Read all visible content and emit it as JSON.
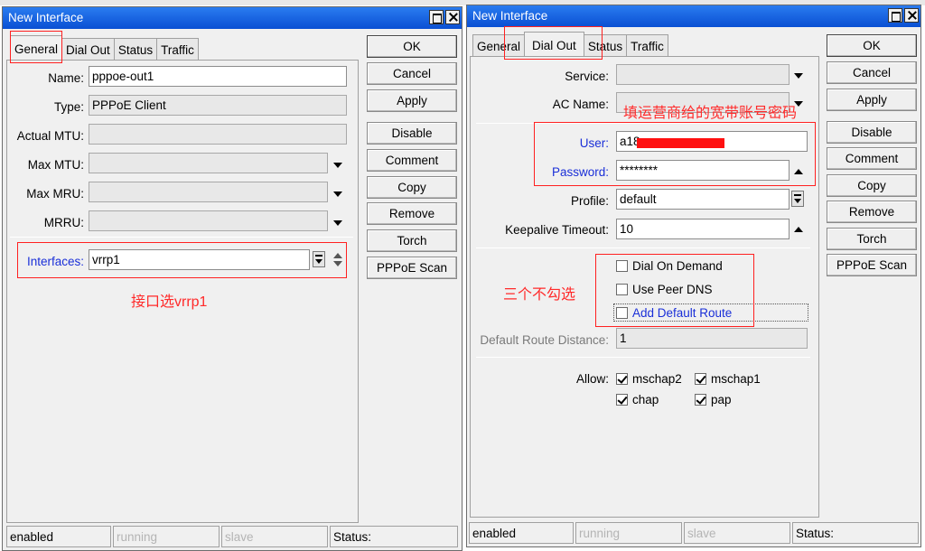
{
  "left_window": {
    "title": "New Interface",
    "tabs": [
      "General",
      "Dial Out",
      "Status",
      "Traffic"
    ],
    "active_tab": "General",
    "fields": {
      "name": {
        "label": "Name:",
        "value": "pppoe-out1"
      },
      "type": {
        "label": "Type:",
        "value": "PPPoE Client"
      },
      "actual_mtu": {
        "label": "Actual MTU:",
        "value": ""
      },
      "max_mtu": {
        "label": "Max MTU:",
        "value": ""
      },
      "max_mru": {
        "label": "Max MRU:",
        "value": ""
      },
      "mrru": {
        "label": "MRRU:",
        "value": ""
      },
      "interfaces": {
        "label": "Interfaces:",
        "value": "vrrp1"
      }
    },
    "buttons": [
      "OK",
      "Cancel",
      "Apply",
      "Disable",
      "Comment",
      "Copy",
      "Remove",
      "Torch",
      "PPPoE Scan"
    ],
    "status": [
      "enabled",
      "running",
      "slave",
      "Status:"
    ],
    "annotation": "接口选vrrp1"
  },
  "right_window": {
    "title": "New Interface",
    "tabs": [
      "General",
      "Dial Out",
      "Status",
      "Traffic"
    ],
    "active_tab": "Dial Out",
    "fields": {
      "service": {
        "label": "Service:",
        "value": ""
      },
      "ac_name": {
        "label": "AC Name:",
        "value": ""
      },
      "user": {
        "label": "User:",
        "value": "a18"
      },
      "password": {
        "label": "Password:",
        "value": "********"
      },
      "profile": {
        "label": "Profile:",
        "value": "default"
      },
      "keepalive": {
        "label": "Keepalive Timeout:",
        "value": "10"
      },
      "default_route_distance": {
        "label": "Default Route Distance:",
        "value": "1"
      }
    },
    "checkboxes": {
      "dial_on_demand": {
        "label": "Dial On Demand",
        "checked": false
      },
      "use_peer_dns": {
        "label": "Use Peer DNS",
        "checked": false
      },
      "add_default_route": {
        "label": "Add Default Route",
        "checked": false
      }
    },
    "allow": {
      "label": "Allow:",
      "mschap2": {
        "label": "mschap2",
        "checked": true
      },
      "mschap1": {
        "label": "mschap1",
        "checked": true
      },
      "chap": {
        "label": "chap",
        "checked": true
      },
      "pap": {
        "label": "pap",
        "checked": true
      }
    },
    "buttons": [
      "OK",
      "Cancel",
      "Apply",
      "Disable",
      "Comment",
      "Copy",
      "Remove",
      "Torch",
      "PPPoE Scan"
    ],
    "status": [
      "enabled",
      "running",
      "slave",
      "Status:"
    ],
    "annotation_account": "填运营商给的宽带账号密码",
    "annotation_checkboxes": "三个不勾选"
  },
  "colors": {
    "title_bar": "#0a4fd3",
    "annotation_red": "#ff2020",
    "blue_label": "#1a2fd8"
  }
}
